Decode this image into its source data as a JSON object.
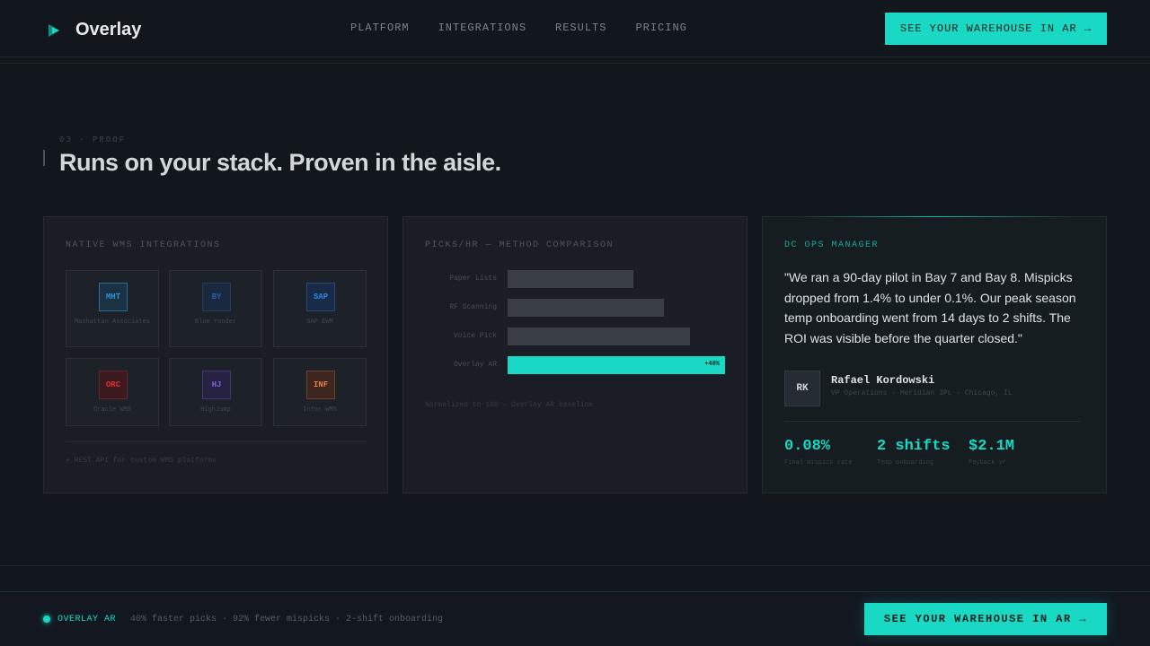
{
  "nav": {
    "brand": "Overlay",
    "links": [
      "PLATFORM",
      "INTEGRATIONS",
      "RESULTS",
      "PRICING"
    ],
    "cta": "SEE YOUR WAREHOUSE IN AR →"
  },
  "section": {
    "eyebrow": "03 · PROOF",
    "title": "Runs on your stack. Proven in the aisle."
  },
  "integrations": {
    "label": "NATIVE WMS INTEGRATIONS",
    "items": [
      {
        "code": "MHT",
        "name": "Manhattan Associates",
        "color": "#2f8fd6"
      },
      {
        "code": "BY",
        "name": "Blue Yonder",
        "color": "#2d5fa8"
      },
      {
        "code": "SAP",
        "name": "SAP EWM",
        "color": "#1f73c9"
      },
      {
        "code": "ORC",
        "name": "Oracle WMS",
        "color": "#d32d2d"
      },
      {
        "code": "HJ",
        "name": "HighJump",
        "color": "#6a4fc4"
      },
      {
        "code": "INF",
        "name": "Infor WMS",
        "color": "#e8743b"
      }
    ],
    "footnote": "+ REST API for custom WMS platforms"
  },
  "comparison": {
    "label": "PICKS/HR — METHOD COMPARISON",
    "note": "Normalized to 100 · Overlay AR baseline"
  },
  "chart_data": {
    "type": "bar",
    "title": "PICKS/HR — METHOD COMPARISON",
    "categories": [
      "Paper Lists",
      "RF Scanning",
      "Voice Pick",
      "Overlay AR"
    ],
    "values": [
      58,
      72,
      84,
      100
    ],
    "data_labels": [
      "",
      "",
      "",
      "+40%"
    ],
    "highlight": "Overlay AR",
    "xlim": [
      0,
      100
    ],
    "colors": {
      "default": "#3a3f46",
      "highlight": "#19d9c4"
    }
  },
  "testimonial": {
    "label": "DC OPS MANAGER",
    "quote": "\"We ran a 90-day pilot in Bay 7 and Bay 8. Mispicks dropped from 1.4% to under 0.1%. Our peak season temp onboarding went from 14 days to 2 shifts. The ROI was visible before the quarter closed.\"",
    "initials": "RK",
    "name": "Rafael Kordowski",
    "role": "VP Operations · Meridian 3PL · Chicago, IL",
    "stats": [
      {
        "value": "0.08%",
        "label": "Final mispick rate"
      },
      {
        "value": "2 shifts",
        "label": "Temp onboarding"
      },
      {
        "value": "$2.1M",
        "label": "Payback yr"
      }
    ]
  },
  "footer": {
    "brand": "OVERLAY AR",
    "tagline": "40% faster picks · 92% fewer mispicks · 2-shift onboarding",
    "cta": "SEE YOUR WAREHOUSE IN AR →"
  },
  "colors": {
    "accent": "#19d9c4",
    "background": "#12161d"
  }
}
